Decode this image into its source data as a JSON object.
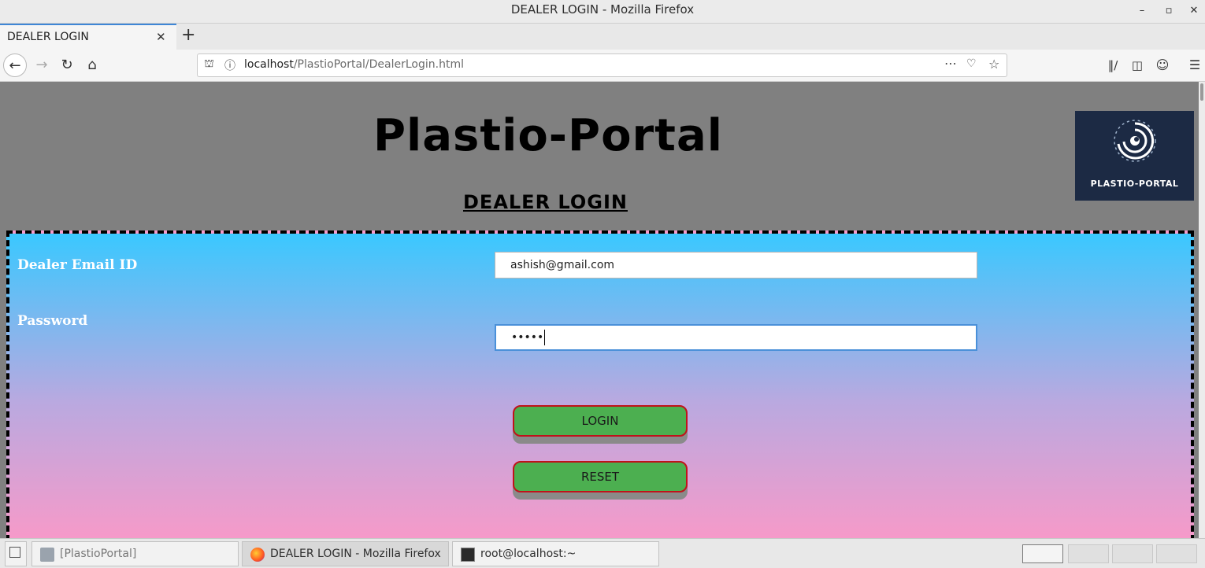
{
  "window": {
    "title": "DEALER LOGIN - Mozilla Firefox"
  },
  "tab": {
    "label": "DEALER LOGIN"
  },
  "url": {
    "host": "localhost",
    "path": "/PlastioPortal/DealerLogin.html"
  },
  "page": {
    "heading": "Plastio-Portal",
    "subheading": "DEALER LOGIN",
    "logo_text": "PLASTIO-PORTAL"
  },
  "form": {
    "email_label": "Dealer Email ID",
    "email_value": "ashish@gmail.com",
    "password_label": "Password",
    "password_value": "•••••",
    "login_label": "LOGIN",
    "reset_label": "RESET"
  },
  "taskbar": {
    "items": [
      {
        "label": "[PlastioPortal]"
      },
      {
        "label": "DEALER LOGIN - Mozilla Firefox"
      },
      {
        "label": "root@localhost:~"
      }
    ]
  },
  "colors": {
    "form_gradient_top": "#3ac8ff",
    "form_gradient_bottom": "#f69ac9",
    "button_fill": "#4caf50",
    "button_border": "#c0121b",
    "page_background": "#808080",
    "logo_background": "#1c2a44"
  }
}
